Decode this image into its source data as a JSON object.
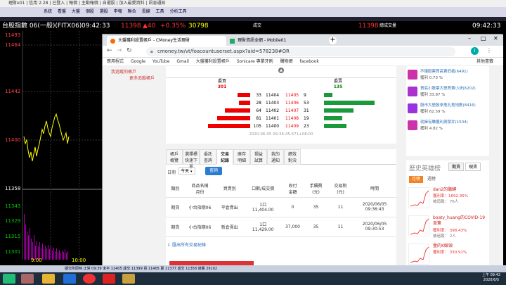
{
  "app": {
    "title": "理財e01 | 信用 2.28 | 已登入 | 報價 | 主動報價 | 自選股 | 加入最愛資料 | 訊息通知",
    "menu": [
      "系統",
      "看盤",
      "大盤",
      "個股",
      "選股",
      "申報",
      "聯合",
      "長線",
      "工具",
      "分析工具"
    ],
    "ticker_name": "台股指數 06(一般)(FITX06)",
    "time": "09:42:33",
    "price": "11398",
    "change": "▲40",
    "pct": "+0.35%",
    "volume": "30798",
    "label_vol": "成交",
    "right_price": "11398",
    "right_label": "總成交量",
    "right_time": "09:42:33",
    "y_ticks": [
      "11493",
      "11464",
      "11442",
      "11400",
      "11358",
      "11343",
      "11329",
      "11315",
      "11301"
    ],
    "x_ticks": [
      "9:00",
      "10:00"
    ]
  },
  "browser": {
    "tab1": "大盤獲利設置帳戶 - CMoney生活理財",
    "tab2": "理財資訊全網 - Mobile01",
    "url": "cmoney.tw/vt/foacountuserset.aspx?aid=578238#OR",
    "bookmarks": [
      "應用程式",
      "Google",
      "YouTube",
      "Gmail",
      "大盤獲利設置帳戶",
      "Sonicare 專業牙刷",
      "購物網",
      "facebook"
    ],
    "other_bookmarks": "其他書籤"
  },
  "sidebar_left": {
    "line1": "我追蹤的帳戶",
    "line2": "更多追蹤帳戶"
  },
  "orderbook": {
    "buy_label": "委買",
    "buy_total": "301",
    "sell_label": "委賣",
    "sell_total": "135",
    "rows": [
      {
        "bid_vol": "33",
        "bid": "11404",
        "ask": "11405",
        "ask_vol": "9",
        "bid_frac": 0.3,
        "ask_frac": 0.12
      },
      {
        "bid_vol": "28",
        "bid": "11403",
        "ask": "11406",
        "ask_vol": "53",
        "bid_frac": 0.26,
        "ask_frac": 0.72
      },
      {
        "bid_vol": "64",
        "bid": "11402",
        "ask": "11407",
        "ask_vol": "31",
        "bid_frac": 0.6,
        "ask_frac": 0.42
      },
      {
        "bid_vol": "81",
        "bid": "11401",
        "ask": "11408",
        "ask_vol": "19",
        "bid_frac": 0.78,
        "ask_frac": 0.26
      },
      {
        "bid_vol": "105",
        "bid": "11400",
        "ask": "11409",
        "ask_vol": "23",
        "bid_frac": 1.0,
        "ask_frac": 0.32
      }
    ],
    "timestamp": "2020-06-05 09:36:45.671+08:00"
  },
  "tabs": [
    {
      "l1": "帳戶",
      "l2": "概覽"
    },
    {
      "l1": "選擇標",
      "l2": "快速下單"
    },
    {
      "l1": "委託",
      "l2": "查詢"
    },
    {
      "l1": "交易",
      "l2": "紀錄"
    },
    {
      "l1": "庫存",
      "l2": "明細"
    },
    {
      "l1": "損益",
      "l2": "試算"
    },
    {
      "l1": "我的",
      "l2": "通知"
    },
    {
      "l1": "績效",
      "l2": "對決"
    }
  ],
  "filter": {
    "date_label": "日期",
    "date_value": "今天",
    "query_button": "查詢"
  },
  "history": {
    "headers": [
      "類別",
      "商品名稱\n月份",
      "買賣別",
      "口數/成交價",
      "收付\n金額",
      "手續費\n(元)",
      "交易稅\n(元)",
      "時間"
    ],
    "rows": [
      {
        "type": "期貨",
        "product": "小台指期06",
        "side": "平倉賣出",
        "lots": "1口",
        "price": "11,404.00",
        "amount": "0",
        "fee": "35",
        "tax": "11",
        "date": "2020/06/05",
        "time": "09:36:43"
      },
      {
        "type": "期貨",
        "product": "小台指期06",
        "side": "新倉賣出",
        "lots": "1口",
        "price": "11,429.00",
        "amount": "37,000",
        "fee": "35",
        "tax": "11",
        "date": "2020/06/05",
        "time": "09:30:53"
      }
    ],
    "export_link": "匯出所有交易紀錄"
  },
  "right_list": [
    {
      "title": "不懂股票買高賣低者(6491)",
      "stat": "獲利 0.73 %"
    },
    {
      "title": "買底小股票大壆買賣小決(6202)",
      "stat": "獲利 33.87 %"
    },
    {
      "title": "股市大壆股來鬼孔鬼地數(8416)",
      "stat": "獲利 62.59 %"
    },
    {
      "title": "就擁有賺獲利測學弁(1504)",
      "stat": "獲利 4.82 %"
    }
  ],
  "history_rank": {
    "title": "歷史英雄榜",
    "tab_futures": "期貨",
    "tab_stock": "現貨",
    "period_month": "月榜",
    "period_week": "週榜",
    "entries": [
      {
        "name": "dan2的聽轉",
        "stat": "獲利率：1692.35%",
        "followers": "被追蹤： 76人"
      },
      {
        "name": "boaty_huang的COVID-19 頁簽",
        "stat": "獲利率： 398.43%",
        "followers": "被追蹤： 2人"
      },
      {
        "name": "量的K線領",
        "stat": "獲利率： 330.91%",
        "followers": ""
      }
    ]
  },
  "statusbar": "期交所即時 正常 09:39 未平 11405 成交 11399 買 11405 賣 11377 成交 11358 總量 29102",
  "taskbar": {
    "time": "上午 09:42",
    "date": "2020/6/5"
  }
}
